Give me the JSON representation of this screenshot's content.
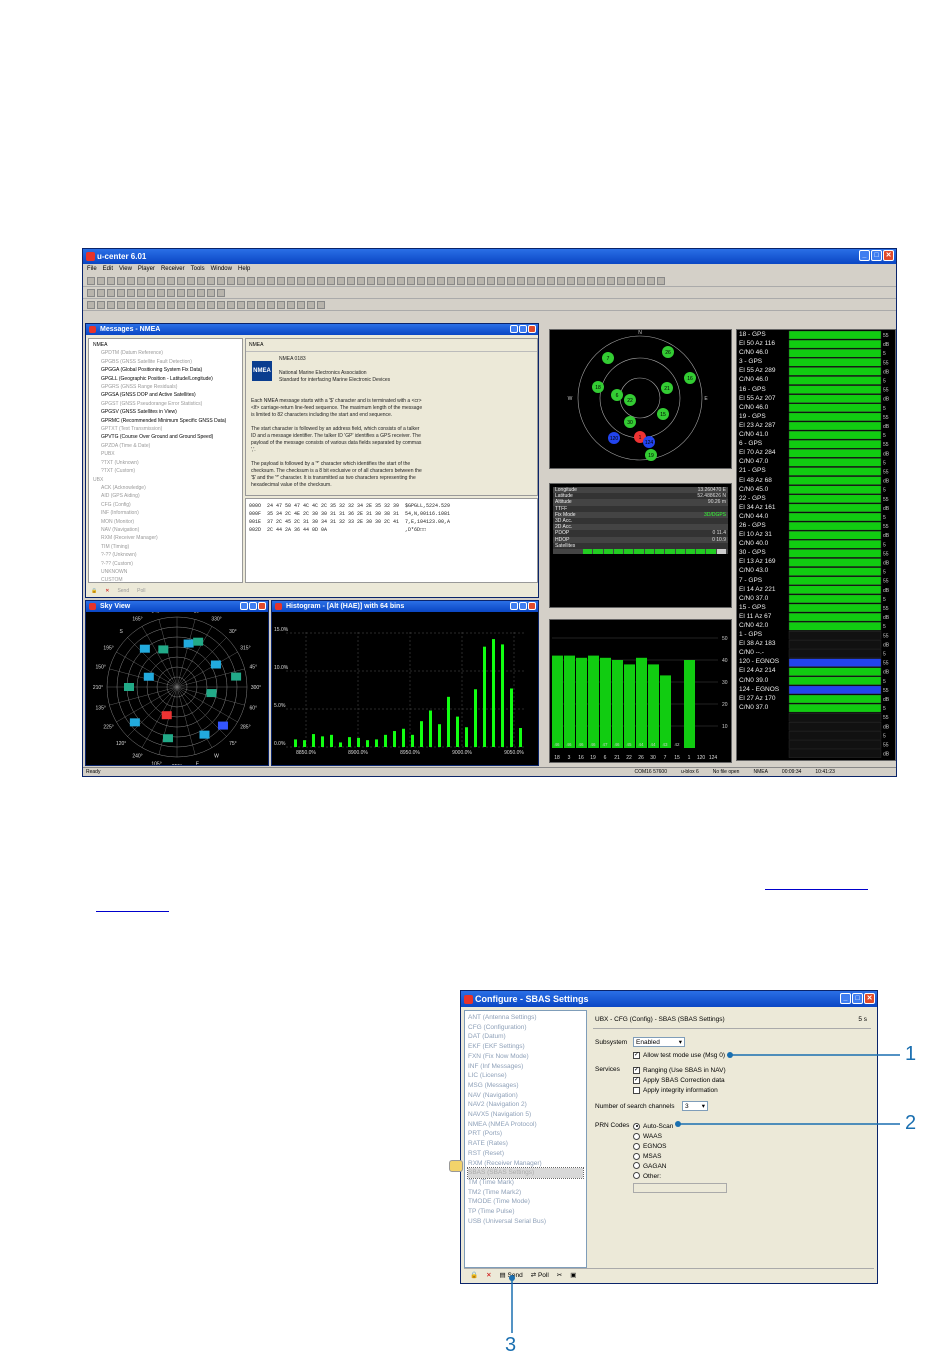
{
  "app": {
    "title": "u-center 6.01",
    "menu": [
      "File",
      "Edit",
      "View",
      "Player",
      "Receiver",
      "Tools",
      "Window",
      "Help"
    ],
    "status": {
      "left": "Ready",
      "port": "COM16 57600",
      "ublox": "u-blox 6",
      "file": "No file open",
      "proto": "NMEA",
      "t1": "00:09:34",
      "t2": "10:41:23"
    }
  },
  "messages": {
    "title": "Messages - NMEA",
    "tree": [
      {
        "t": "NMEA",
        "on": true
      },
      {
        "t": "GPDTM (Datum Reference)",
        "on": false
      },
      {
        "t": "GPGBS (GNSS Satellite Fault Detection)",
        "on": false
      },
      {
        "t": "GPGGA (Global Positioning System Fix Data)",
        "on": true
      },
      {
        "t": "GPGLL (Geographic Position - Latitude/Longitude)",
        "on": true
      },
      {
        "t": "GPGRS (GNSS Range Residuals)",
        "on": false
      },
      {
        "t": "GPGSA (GNSS DOP and Active Satellites)",
        "on": true
      },
      {
        "t": "GPGST (GNSS Pseudorange Error Statistics)",
        "on": false
      },
      {
        "t": "GPGSV (GNSS Satellites in View)",
        "on": true
      },
      {
        "t": "GPRMC (Recommended Minimum Specific GNSS Data)",
        "on": true
      },
      {
        "t": "GPTXT (Text Transmission)",
        "on": false
      },
      {
        "t": "GPVTG (Course Over Ground and Ground Speed)",
        "on": true
      },
      {
        "t": "GPZDA (Time & Date)",
        "on": false
      },
      {
        "t": "PUBX",
        "on": false
      },
      {
        "t": "?TXT (Unknown)",
        "on": false
      },
      {
        "t": "?TXT (Custom)",
        "on": false
      },
      {
        "t": "UBX",
        "on": false
      },
      {
        "t": "ACK (Acknowledge)",
        "on": false
      },
      {
        "t": "AID (GPS Aiding)",
        "on": false
      },
      {
        "t": "CFG (Config)",
        "on": false
      },
      {
        "t": "INF (Information)",
        "on": false
      },
      {
        "t": "MON (Monitor)",
        "on": false
      },
      {
        "t": "NAV (Navigation)",
        "on": false
      },
      {
        "t": "RXM (Receiver Manager)",
        "on": false
      },
      {
        "t": "TIM (Timing)",
        "on": false
      },
      {
        "t": "?-?? (Unknown)",
        "on": false
      },
      {
        "t": "?-?? (Custom)",
        "on": false
      },
      {
        "t": "UNKNOWN",
        "on": false
      },
      {
        "t": "CUSTOM",
        "on": false
      }
    ],
    "header": "NMEA",
    "logo": "NMEA",
    "std": "NMEA 0183",
    "org": "National Marine Electronics Association",
    "orgsub": "Standard for interfacing Marine Electronic Devices",
    "p1": "Each NMEA message starts with a '$' character and is terminated with a <cr> <lf> carriage-return line-feed sequence. The maximum length of the message is limited to 82 characters including the start and end sequence.",
    "p2": "The start character is followed by an address field, which consists of a talker ID and a message identifier. The talker ID 'GP' identifies a GPS receiver. The payload of the message consists of various data fields separated by commas ','.",
    "p3": "The payload is followed by a '*' character which identifies the start of the checksum. The checksum is a 8 bit exclusive or of all characters between the '$' and the '*' character. It is transmitted as two characters representing the hexadecimal value of the checksum.",
    "hex": [
      "000O  24 47 50 47 4C 4C 2C 35 32 32 34 2E 35 32 39  $GPGLL,5224.529",
      "000F  35 34 2C 4E 2C 30 30 31 31 36 2E 31 30 38 31  54,N,00116.1081",
      "001E  37 2C 45 2C 31 30 34 31 32 33 2E 30 30 2C 41  7,E,104123.00,A",
      "002D  2C 44 2A 36 44 0D 0A                          ,D*6D□□"
    ],
    "bottom": [
      "Send",
      "Poll"
    ]
  },
  "sky": {
    "title": "Sky View",
    "az": [
      "345°",
      "N 0°",
      "15°",
      "330°",
      "30°",
      "315°",
      "45°",
      "300°",
      "60°",
      "285°",
      "75°",
      "W",
      "E",
      "255°",
      "105°",
      "240°",
      "120°",
      "225°",
      "135°",
      "210°",
      "150°",
      "195°",
      "S",
      "165°"
    ]
  },
  "histo": {
    "title": "Histogram - [Alt (HAE)] with 64 bins",
    "ylabels": [
      "15.0%",
      "10.0%",
      "5.0%",
      "0.0%"
    ],
    "xlabels": [
      "8850.0%",
      "8900.0%",
      "8950.0%",
      "9000.0%",
      "9050.0%"
    ],
    "bars": [
      1,
      0.9,
      1.7,
      1.4,
      1.6,
      0.6,
      1.3,
      1.2,
      0.9,
      1.0,
      1.6,
      2.1,
      2.4,
      1.6,
      3.4,
      4.8,
      3.0,
      6.6,
      4.0,
      2.6,
      7.6,
      13.2,
      14.2,
      13.5,
      7.7,
      2.5
    ]
  },
  "info": {
    "rows": [
      {
        "k": "Longitude",
        "v": "13.260470 E"
      },
      {
        "k": "Latitude",
        "v": "52.488626 N"
      },
      {
        "k": "Altitude",
        "v": "90.26 m"
      },
      {
        "k": "TTFF",
        "v": ""
      },
      {
        "k": "Fix Mode",
        "v": "3D/DGPS"
      },
      {
        "k": "3D Acc.",
        "v": ""
      },
      {
        "k": "2D Acc.",
        "v": ""
      },
      {
        "k": "PDOP",
        "v": "0     11.4"
      },
      {
        "k": "HDOP",
        "v": "0     10.9"
      },
      {
        "k": "Satellites",
        "v": ""
      }
    ]
  },
  "signal": {
    "bars": [
      42,
      42,
      41,
      42,
      41,
      40,
      38,
      41,
      38,
      33,
      0,
      40,
      0,
      0
    ],
    "labels1": [
      "46",
      "46",
      "46",
      "46",
      "47",
      "46",
      "45",
      "44",
      "44",
      "43",
      "42",
      ""
    ],
    "labels2": [
      "18",
      "3",
      "16",
      "19",
      "6",
      "21",
      "22",
      "26",
      "30",
      "7",
      "15",
      "1",
      "120",
      "124"
    ],
    "ylabels": [
      "50",
      "40",
      "30",
      "20",
      "10"
    ]
  },
  "satlist": [
    [
      "18 - GPS",
      "El 50 Az 116",
      "C/N0 46.0"
    ],
    [
      "3 - GPS",
      "El 55 Az 289",
      "C/N0 46.0"
    ],
    [
      "16 - GPS",
      "El 55 Az 207",
      "C/N0 46.0"
    ],
    [
      "19 - GPS",
      "El 23 Az 287",
      "C/N0 41.0"
    ],
    [
      "6 - GPS",
      "El 70 Az 284",
      "C/N0 47.0"
    ],
    [
      "21 - GPS",
      "El 48 Az 68",
      "C/N0 45.0"
    ],
    [
      "22 - GPS",
      "El 34 Az 161",
      "C/N0 44.0"
    ],
    [
      "26 - GPS",
      "El 10 Az 31",
      "C/N0 40.0"
    ],
    [
      "30 - GPS",
      "El 13 Az 169",
      "C/N0 43.0"
    ],
    [
      "7 - GPS",
      "El 14 Az 221",
      "C/N0 37.0"
    ],
    [
      "15 - GPS",
      "El 11 Az 67",
      "C/N0 42.0"
    ],
    [
      "1 - GPS",
      "El 38 Az 183",
      "C/N0 --.-"
    ],
    [
      "120 - EGNOS",
      "El 24 Az 214",
      "C/N0 39.0"
    ],
    [
      "124 - EGNOS",
      "El 27 Az 170",
      "C/N0 37.0"
    ]
  ],
  "config": {
    "title": "Configure - SBAS Settings",
    "tree": [
      "ANT (Antenna Settings)",
      "CFG (Configuration)",
      "DAT (Datum)",
      "EKF (EKF Settings)",
      "FXN (Fix Now Mode)",
      "INF (Inf Messages)",
      "LIC (License)",
      "MSG (Messages)",
      "NAV (Navigation)",
      "NAV2 (Navigation 2)",
      "NAVX5 (Navigation 5)",
      "NMEA (NMEA Protocol)",
      "PRT (Ports)",
      "RATE (Rates)",
      "RST (Reset)",
      "RXM (Receiver Manager)",
      "SBAS (SBAS Settings)",
      "TM (Time Mark)",
      "TM2 (Time Mark2)",
      "TMODE (Time Mode)",
      "TP (Time Pulse)",
      "USB (Universal Serial Bus)"
    ],
    "selected": 16,
    "header": "UBX - CFG (Config) - SBAS (SBAS Settings)",
    "secs": "5 s",
    "subsystem_label": "Subsystem",
    "subsystem_value": "Enabled",
    "allow_test": "Allow test mode use (Msg 0)",
    "services_label": "Services",
    "svc": [
      "Ranging (Use SBAS in NAV)",
      "Apply SBAS Correction data",
      "Apply integrity information"
    ],
    "svc_checked": [
      true,
      true,
      false
    ],
    "channels_label": "Number of search channels",
    "channels_value": "3",
    "prn_label": "PRN Codes",
    "prn": [
      "Auto-Scan",
      "WAAS",
      "EGNOS",
      "MSAS",
      "GAGAN",
      "Other:"
    ],
    "send": "Send",
    "poll": "Poll"
  },
  "callouts": [
    "1",
    "2",
    "3"
  ]
}
